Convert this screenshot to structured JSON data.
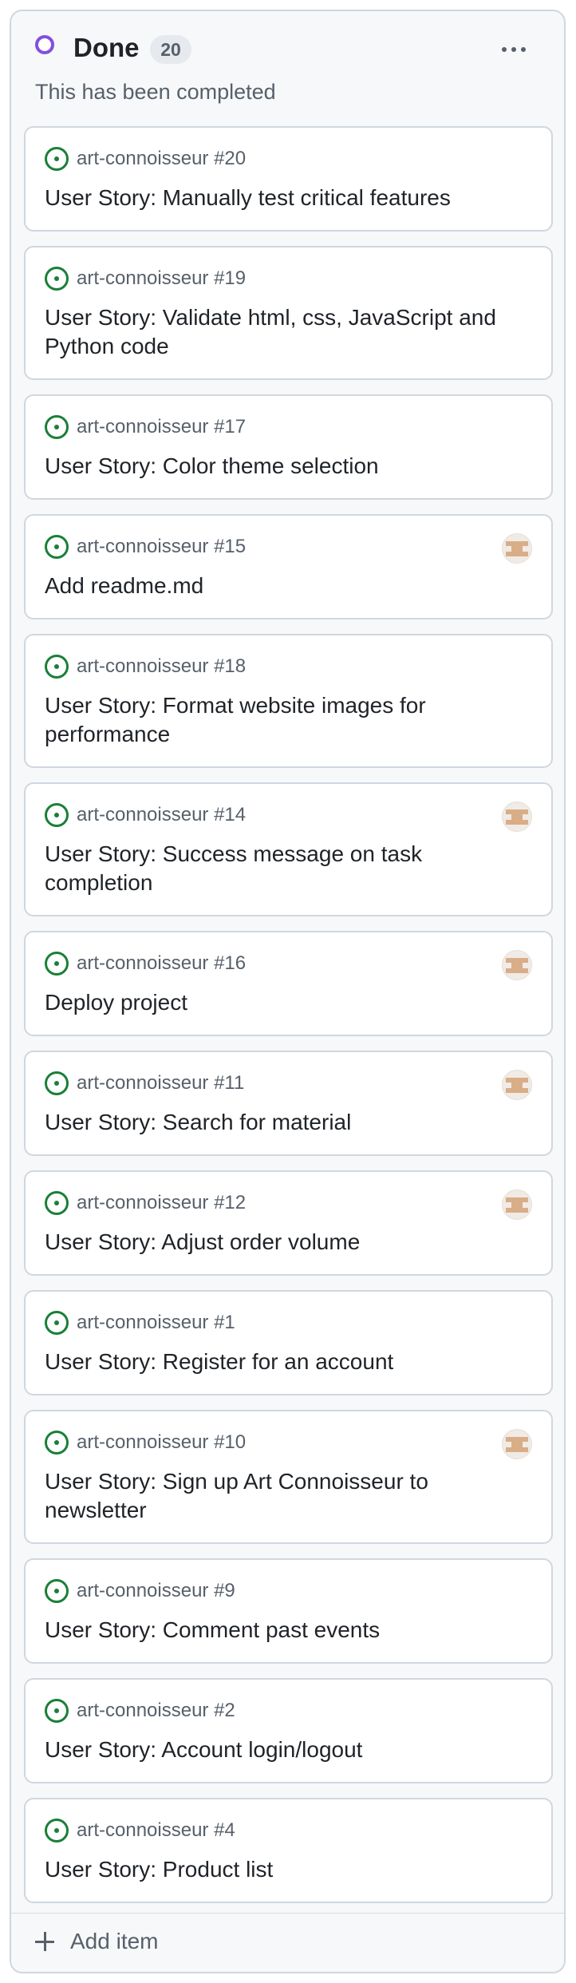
{
  "column": {
    "title": "Done",
    "count": "20",
    "description": "This has been completed",
    "add_item_label": "Add item",
    "status_color": "#8250df"
  },
  "cards": [
    {
      "ref": "art-connoisseur #20",
      "title": "User Story: Manually test critical features",
      "avatar": false
    },
    {
      "ref": "art-connoisseur #19",
      "title": "User Story: Validate html, css, JavaScript and Python code",
      "avatar": false
    },
    {
      "ref": "art-connoisseur #17",
      "title": "User Story: Color theme selection",
      "avatar": false
    },
    {
      "ref": "art-connoisseur #15",
      "title": "Add readme.md",
      "avatar": true
    },
    {
      "ref": "art-connoisseur #18",
      "title": "User Story: Format website images for performance",
      "avatar": false
    },
    {
      "ref": "art-connoisseur #14",
      "title": "User Story: Success message on task completion",
      "avatar": true
    },
    {
      "ref": "art-connoisseur #16",
      "title": "Deploy project",
      "avatar": true
    },
    {
      "ref": "art-connoisseur #11",
      "title": "User Story: Search for material",
      "avatar": true
    },
    {
      "ref": "art-connoisseur #12",
      "title": "User Story: Adjust order volume",
      "avatar": true
    },
    {
      "ref": "art-connoisseur #1",
      "title": "User Story: Register for an account",
      "avatar": false
    },
    {
      "ref": "art-connoisseur #10",
      "title": "User Story: Sign up Art Connoisseur to newsletter",
      "avatar": true
    },
    {
      "ref": "art-connoisseur #9",
      "title": "User Story: Comment past events",
      "avatar": false
    },
    {
      "ref": "art-connoisseur #2",
      "title": "User Story: Account login/logout",
      "avatar": false
    },
    {
      "ref": "art-connoisseur #4",
      "title": "User Story: Product list",
      "avatar": false
    }
  ],
  "icons": {
    "status": "circle-status-icon",
    "issue": "issue-open-icon",
    "menu": "kebab-menu-icon",
    "add": "plus-icon"
  },
  "colors": {
    "issue_open": "#1a7f37",
    "done_status": "#8250df"
  }
}
